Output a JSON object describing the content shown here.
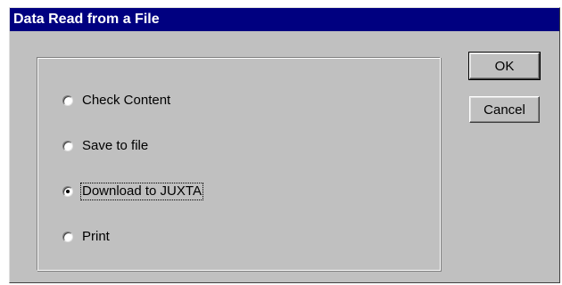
{
  "window": {
    "title": "Data Read from a File"
  },
  "options": {
    "items": [
      {
        "label": "Check Content",
        "selected": false
      },
      {
        "label": "Save to file",
        "selected": false
      },
      {
        "label": "Download to JUXTA",
        "selected": true
      },
      {
        "label": "Print",
        "selected": false
      }
    ]
  },
  "buttons": {
    "ok_label": "OK",
    "cancel_label": "Cancel"
  },
  "colors": {
    "titlebar": "#000080",
    "face": "#c0c0c0"
  }
}
